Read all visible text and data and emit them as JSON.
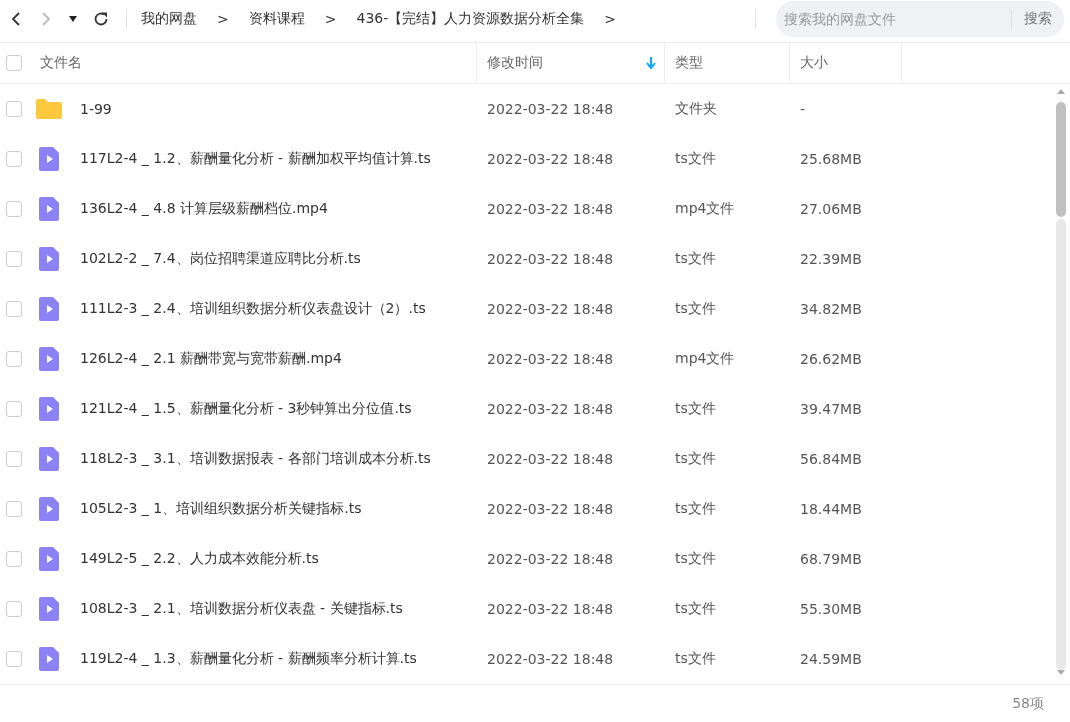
{
  "breadcrumb": [
    "我的网盘",
    "资料课程",
    "436-【完结】人力资源数据分析全集"
  ],
  "breadcrumb_separator": ">",
  "search": {
    "placeholder": "搜索我的网盘文件",
    "button": "搜索"
  },
  "select_all": {
    "checked": false
  },
  "columns": [
    {
      "label": "文件名",
      "sorted": false
    },
    {
      "label": "修改时间",
      "sorted": true
    },
    {
      "label": "类型",
      "sorted": false
    },
    {
      "label": "大小",
      "sorted": false
    }
  ],
  "rows": [
    {
      "kind": "folder",
      "checked": false,
      "name": "1-99",
      "modified": "2022-03-22 18:48",
      "type": "文件夹",
      "size": "-"
    },
    {
      "kind": "video",
      "checked": false,
      "name": "117L2-4 _ 1.2、薪酬量化分析 - 薪酬加权平均值计算.ts",
      "modified": "2022-03-22 18:48",
      "type": "ts文件",
      "size": "25.68MB"
    },
    {
      "kind": "video",
      "checked": false,
      "name": "136L2-4 _ 4.8 计算层级薪酬档位.mp4",
      "modified": "2022-03-22 18:48",
      "type": "mp4文件",
      "size": "27.06MB"
    },
    {
      "kind": "video",
      "checked": false,
      "name": "102L2-2 _ 7.4、岗位招聘渠道应聘比分析.ts",
      "modified": "2022-03-22 18:48",
      "type": "ts文件",
      "size": "22.39MB"
    },
    {
      "kind": "video",
      "checked": false,
      "name": "111L2-3 _ 2.4、培训组织数据分析仪表盘设计（2）.ts",
      "modified": "2022-03-22 18:48",
      "type": "ts文件",
      "size": "34.82MB"
    },
    {
      "kind": "video",
      "checked": false,
      "name": "126L2-4 _ 2.1 薪酬带宽与宽带薪酬.mp4",
      "modified": "2022-03-22 18:48",
      "type": "mp4文件",
      "size": "26.62MB"
    },
    {
      "kind": "video",
      "checked": false,
      "name": "121L2-4 _ 1.5、薪酬量化分析 - 3秒钟算出分位值.ts",
      "modified": "2022-03-22 18:48",
      "type": "ts文件",
      "size": "39.47MB"
    },
    {
      "kind": "video",
      "checked": false,
      "name": "118L2-3 _ 3.1、培训数据报表 - 各部门培训成本分析.ts",
      "modified": "2022-03-22 18:48",
      "type": "ts文件",
      "size": "56.84MB"
    },
    {
      "kind": "video",
      "checked": false,
      "name": "105L2-3 _ 1、培训组织数据分析关键指标.ts",
      "modified": "2022-03-22 18:48",
      "type": "ts文件",
      "size": "18.44MB"
    },
    {
      "kind": "video",
      "checked": false,
      "name": "149L2-5 _ 2.2、人力成本效能分析.ts",
      "modified": "2022-03-22 18:48",
      "type": "ts文件",
      "size": "68.79MB"
    },
    {
      "kind": "video",
      "checked": false,
      "name": "108L2-3 _ 2.1、培训数据分析仪表盘 - 关键指标.ts",
      "modified": "2022-03-22 18:48",
      "type": "ts文件",
      "size": "55.30MB"
    },
    {
      "kind": "video",
      "checked": false,
      "name": "119L2-4 _ 1.3、薪酬量化分析 - 薪酬频率分析计算.ts",
      "modified": "2022-03-22 18:48",
      "type": "ts文件",
      "size": "24.59MB"
    }
  ],
  "item_count": "58项"
}
